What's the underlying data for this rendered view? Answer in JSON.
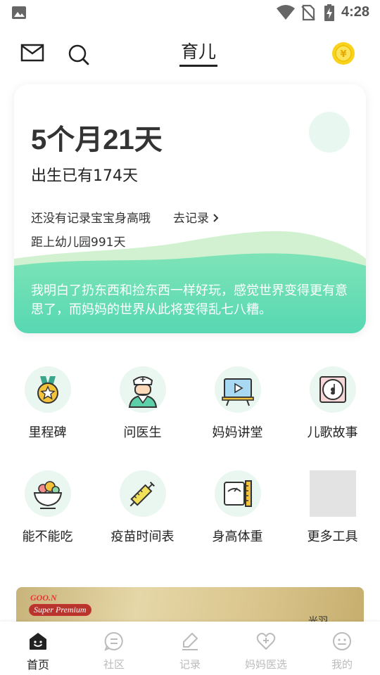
{
  "status_bar": {
    "time": "4:28"
  },
  "header": {
    "title": "育儿"
  },
  "baby_card": {
    "age": "5个月21天",
    "since_birth": "出生已有174天",
    "no_record_text": "还没有记录宝宝身高哦",
    "go_record_label": "去记录",
    "kindergarten": "距上幼儿园991天",
    "quote": "我明白了扔东西和捡东西一样好玩，感觉世界变得更有意思了，而妈妈的世界从此将变得乱七八糟。"
  },
  "tools": [
    {
      "label": "里程碑",
      "icon": "medal-icon"
    },
    {
      "label": "问医生",
      "icon": "nurse-icon"
    },
    {
      "label": "妈妈讲堂",
      "icon": "video-board-icon"
    },
    {
      "label": "儿歌故事",
      "icon": "music-disc-icon"
    },
    {
      "label": "能不能吃",
      "icon": "food-bowl-icon"
    },
    {
      "label": "疫苗时间表",
      "icon": "syringe-icon"
    },
    {
      "label": "身高体重",
      "icon": "scale-icon"
    },
    {
      "label": "更多工具",
      "icon": "placeholder"
    }
  ],
  "banner": {
    "brand": "GOO.N",
    "sub": "Super Premium",
    "right_text": "光羽"
  },
  "tabbar": [
    {
      "label": "首页",
      "icon": "home-icon",
      "active": true
    },
    {
      "label": "社区",
      "icon": "community-icon",
      "active": false
    },
    {
      "label": "记录",
      "icon": "edit-icon",
      "active": false
    },
    {
      "label": "妈妈医选",
      "icon": "health-heart-icon",
      "active": false
    },
    {
      "label": "我的",
      "icon": "profile-icon",
      "active": false
    }
  ],
  "colors": {
    "accent": "#5fd9b0",
    "wave_light": "#c8efc9",
    "tab_inactive": "#bbbbbb"
  }
}
